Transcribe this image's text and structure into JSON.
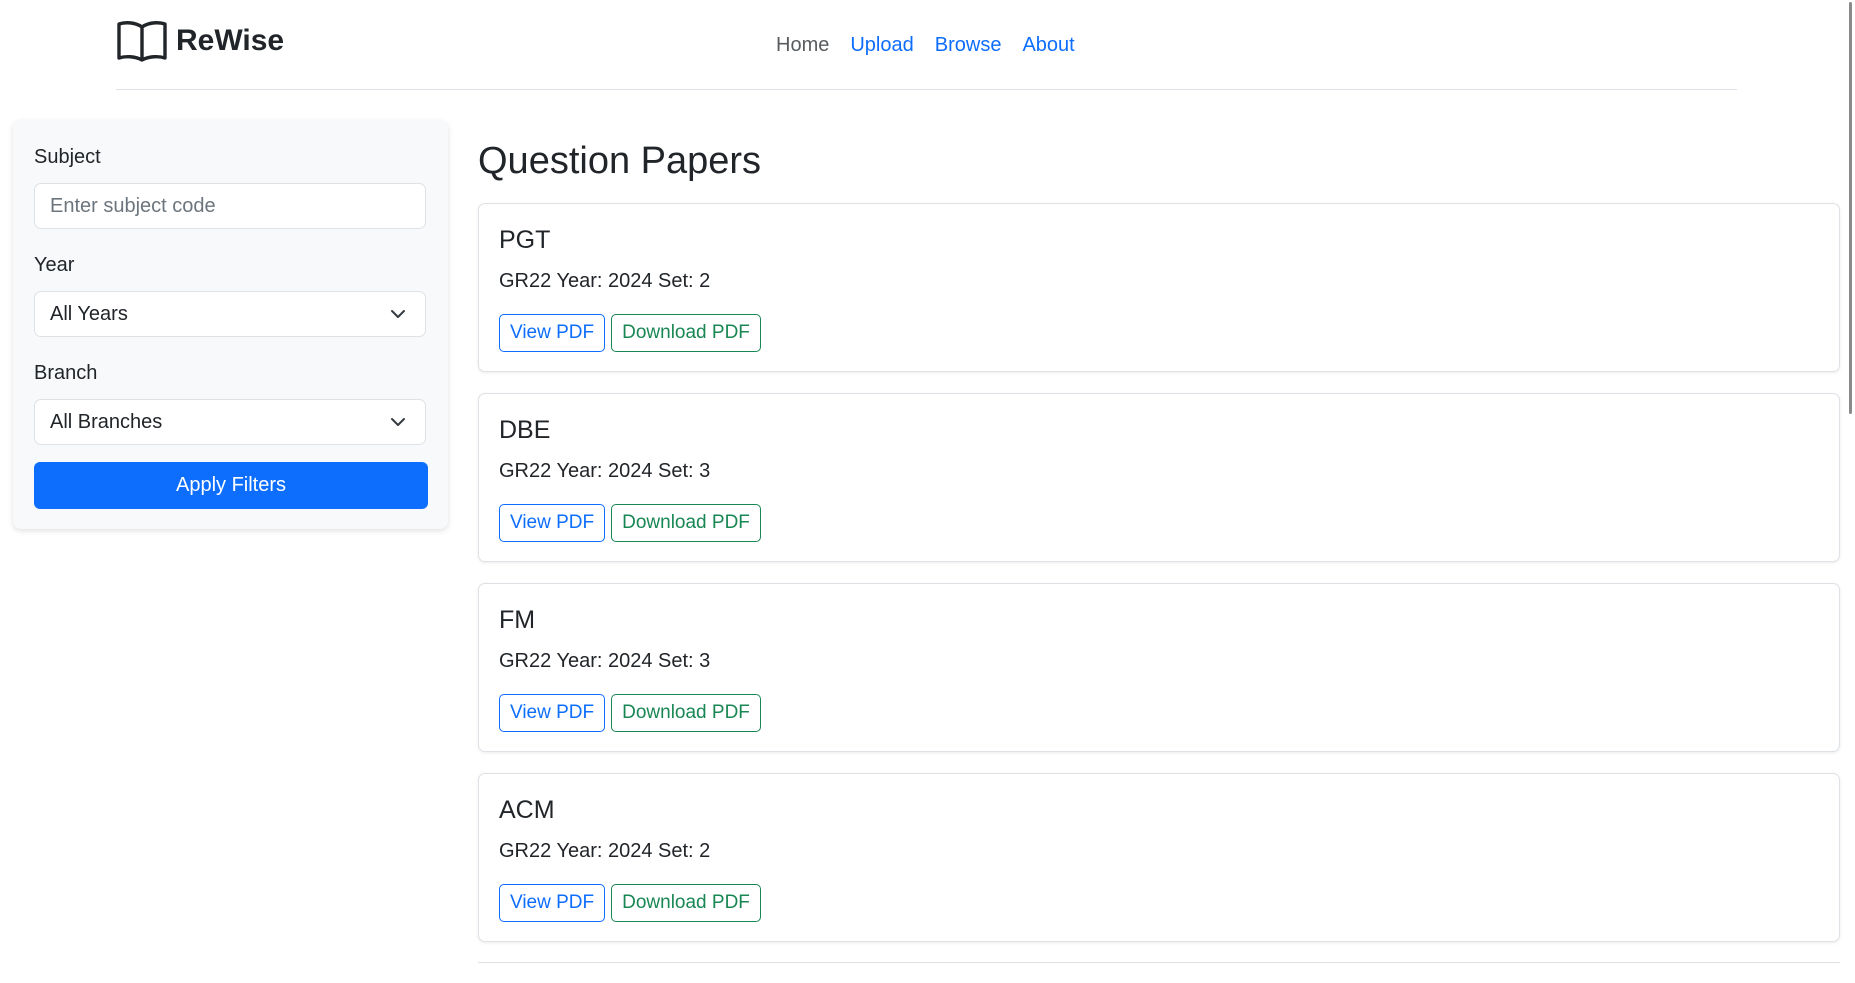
{
  "brand": {
    "name": "ReWise",
    "icon": "open-book-icon"
  },
  "nav": {
    "items": [
      {
        "label": "Home",
        "active": true
      },
      {
        "label": "Upload",
        "active": false
      },
      {
        "label": "Browse",
        "active": false
      },
      {
        "label": "About",
        "active": false
      }
    ]
  },
  "filters": {
    "subject_label": "Subject",
    "subject_placeholder": "Enter subject code",
    "subject_value": "",
    "year_label": "Year",
    "year_selected": "All Years",
    "branch_label": "Branch",
    "branch_selected": "All Branches",
    "apply_label": "Apply Filters"
  },
  "main": {
    "title": "Question Papers",
    "papers": [
      {
        "subject": "PGT",
        "meta": "GR22 Year: 2024 Set: 2",
        "view_label": "View PDF",
        "download_label": "Download PDF"
      },
      {
        "subject": "DBE",
        "meta": "GR22 Year: 2024 Set: 3",
        "view_label": "View PDF",
        "download_label": "Download PDF"
      },
      {
        "subject": "FM",
        "meta": "GR22 Year: 2024 Set: 3",
        "view_label": "View PDF",
        "download_label": "Download PDF"
      },
      {
        "subject": "ACM",
        "meta": "GR22 Year: 2024 Set: 2",
        "view_label": "View PDF",
        "download_label": "Download PDF"
      }
    ]
  },
  "colors": {
    "primary": "#0d6efd",
    "success": "#198754",
    "text": "#212529",
    "muted_nav": "#595c5f",
    "sidebar_bg": "#f8f9fa"
  }
}
